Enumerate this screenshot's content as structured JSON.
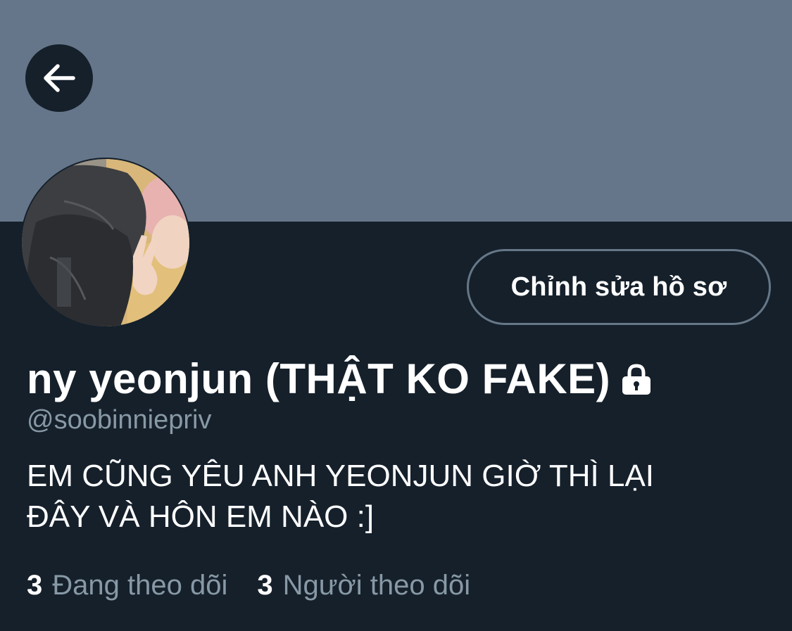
{
  "header": {
    "back_icon": "arrow-left-icon"
  },
  "profile": {
    "avatar_icon": "profile-photo",
    "edit_button_label": "Chỉnh sửa hồ sơ",
    "display_name": "ny yeonjun (THẬT KO FAKE)",
    "protected_icon": "lock-icon",
    "handle": "@soobinniepriv",
    "bio_line_1": "EM CŨNG YÊU ANH YEONJUN GIỜ THÌ LẠI",
    "bio_line_2": "ĐÂY VÀ HÔN EM NÀO :]"
  },
  "stats": {
    "following_count": "3",
    "following_label": "Đang theo dõi",
    "followers_count": "3",
    "followers_label": "Người theo dõi"
  },
  "colors": {
    "banner": "#66768a",
    "background": "#15202b",
    "secondary_text": "#8899a6",
    "button_border": "#667787"
  }
}
